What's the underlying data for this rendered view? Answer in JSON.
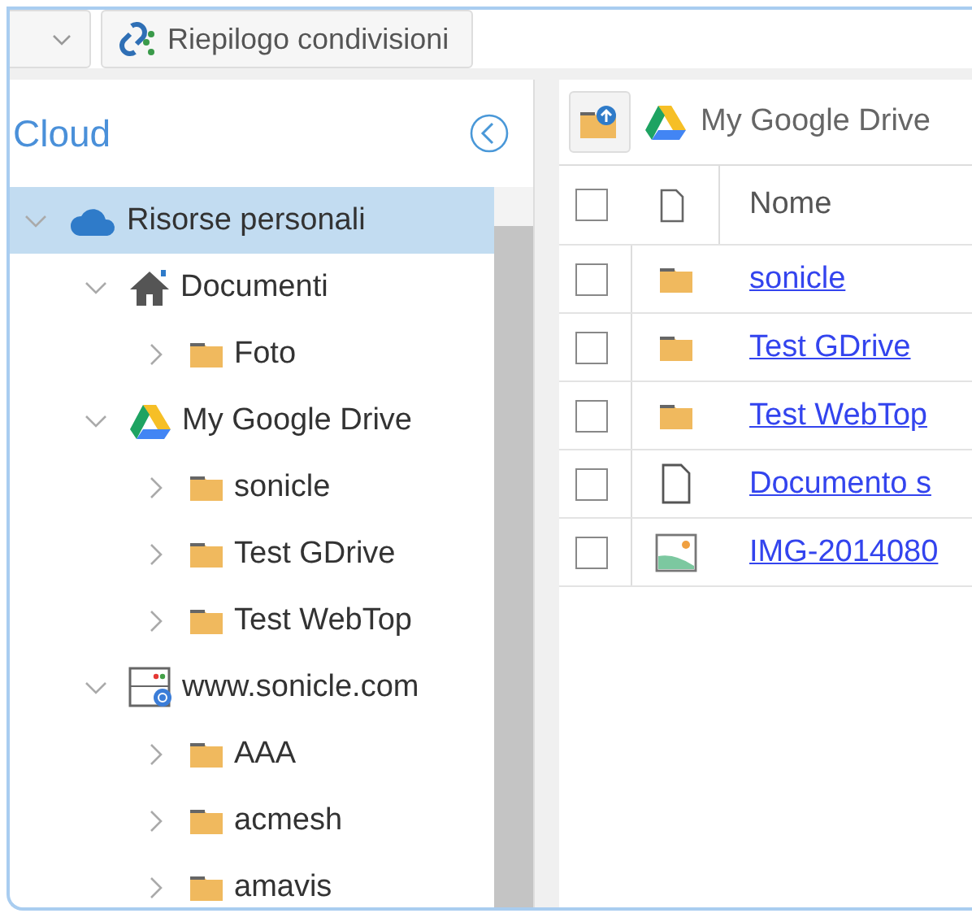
{
  "toolbar": {
    "share_button": {
      "label": "Riepilogo condivisioni"
    }
  },
  "sidebar": {
    "title": "Cloud",
    "tree": [
      {
        "label": "Risorse personali",
        "kind": "cloud",
        "expanded": true,
        "selected": true,
        "children": [
          {
            "label": "Documenti",
            "kind": "home",
            "expanded": true,
            "selected": false,
            "children": [
              {
                "label": "Foto",
                "kind": "folder",
                "expanded": false,
                "selected": false
              }
            ]
          },
          {
            "label": "My Google Drive",
            "kind": "gdrive",
            "expanded": true,
            "selected": false,
            "children": [
              {
                "label": "sonicle",
                "kind": "folder",
                "expanded": false,
                "selected": false
              },
              {
                "label": "Test GDrive",
                "kind": "folder",
                "expanded": false,
                "selected": false
              },
              {
                "label": "Test WebTop",
                "kind": "folder",
                "expanded": false,
                "selected": false
              }
            ]
          },
          {
            "label": "www.sonicle.com",
            "kind": "server",
            "expanded": true,
            "selected": false,
            "children": [
              {
                "label": "AAA",
                "kind": "folder",
                "expanded": false,
                "selected": false
              },
              {
                "label": "acmesh",
                "kind": "folder",
                "expanded": false,
                "selected": false
              },
              {
                "label": "amavis",
                "kind": "folder",
                "expanded": false,
                "selected": false
              }
            ]
          }
        ]
      }
    ]
  },
  "files": {
    "breadcrumb": "My Google Drive",
    "header": {
      "checked": false,
      "name": "Nome"
    },
    "rows": [
      {
        "kind": "folder",
        "name": "sonicle",
        "checked": false
      },
      {
        "kind": "folder",
        "name": "Test GDrive",
        "checked": false
      },
      {
        "kind": "folder",
        "name": "Test WebTop",
        "checked": false
      },
      {
        "kind": "file",
        "name": "Documento s",
        "checked": false
      },
      {
        "kind": "image",
        "name": "IMG-2014080",
        "checked": false
      }
    ]
  }
}
